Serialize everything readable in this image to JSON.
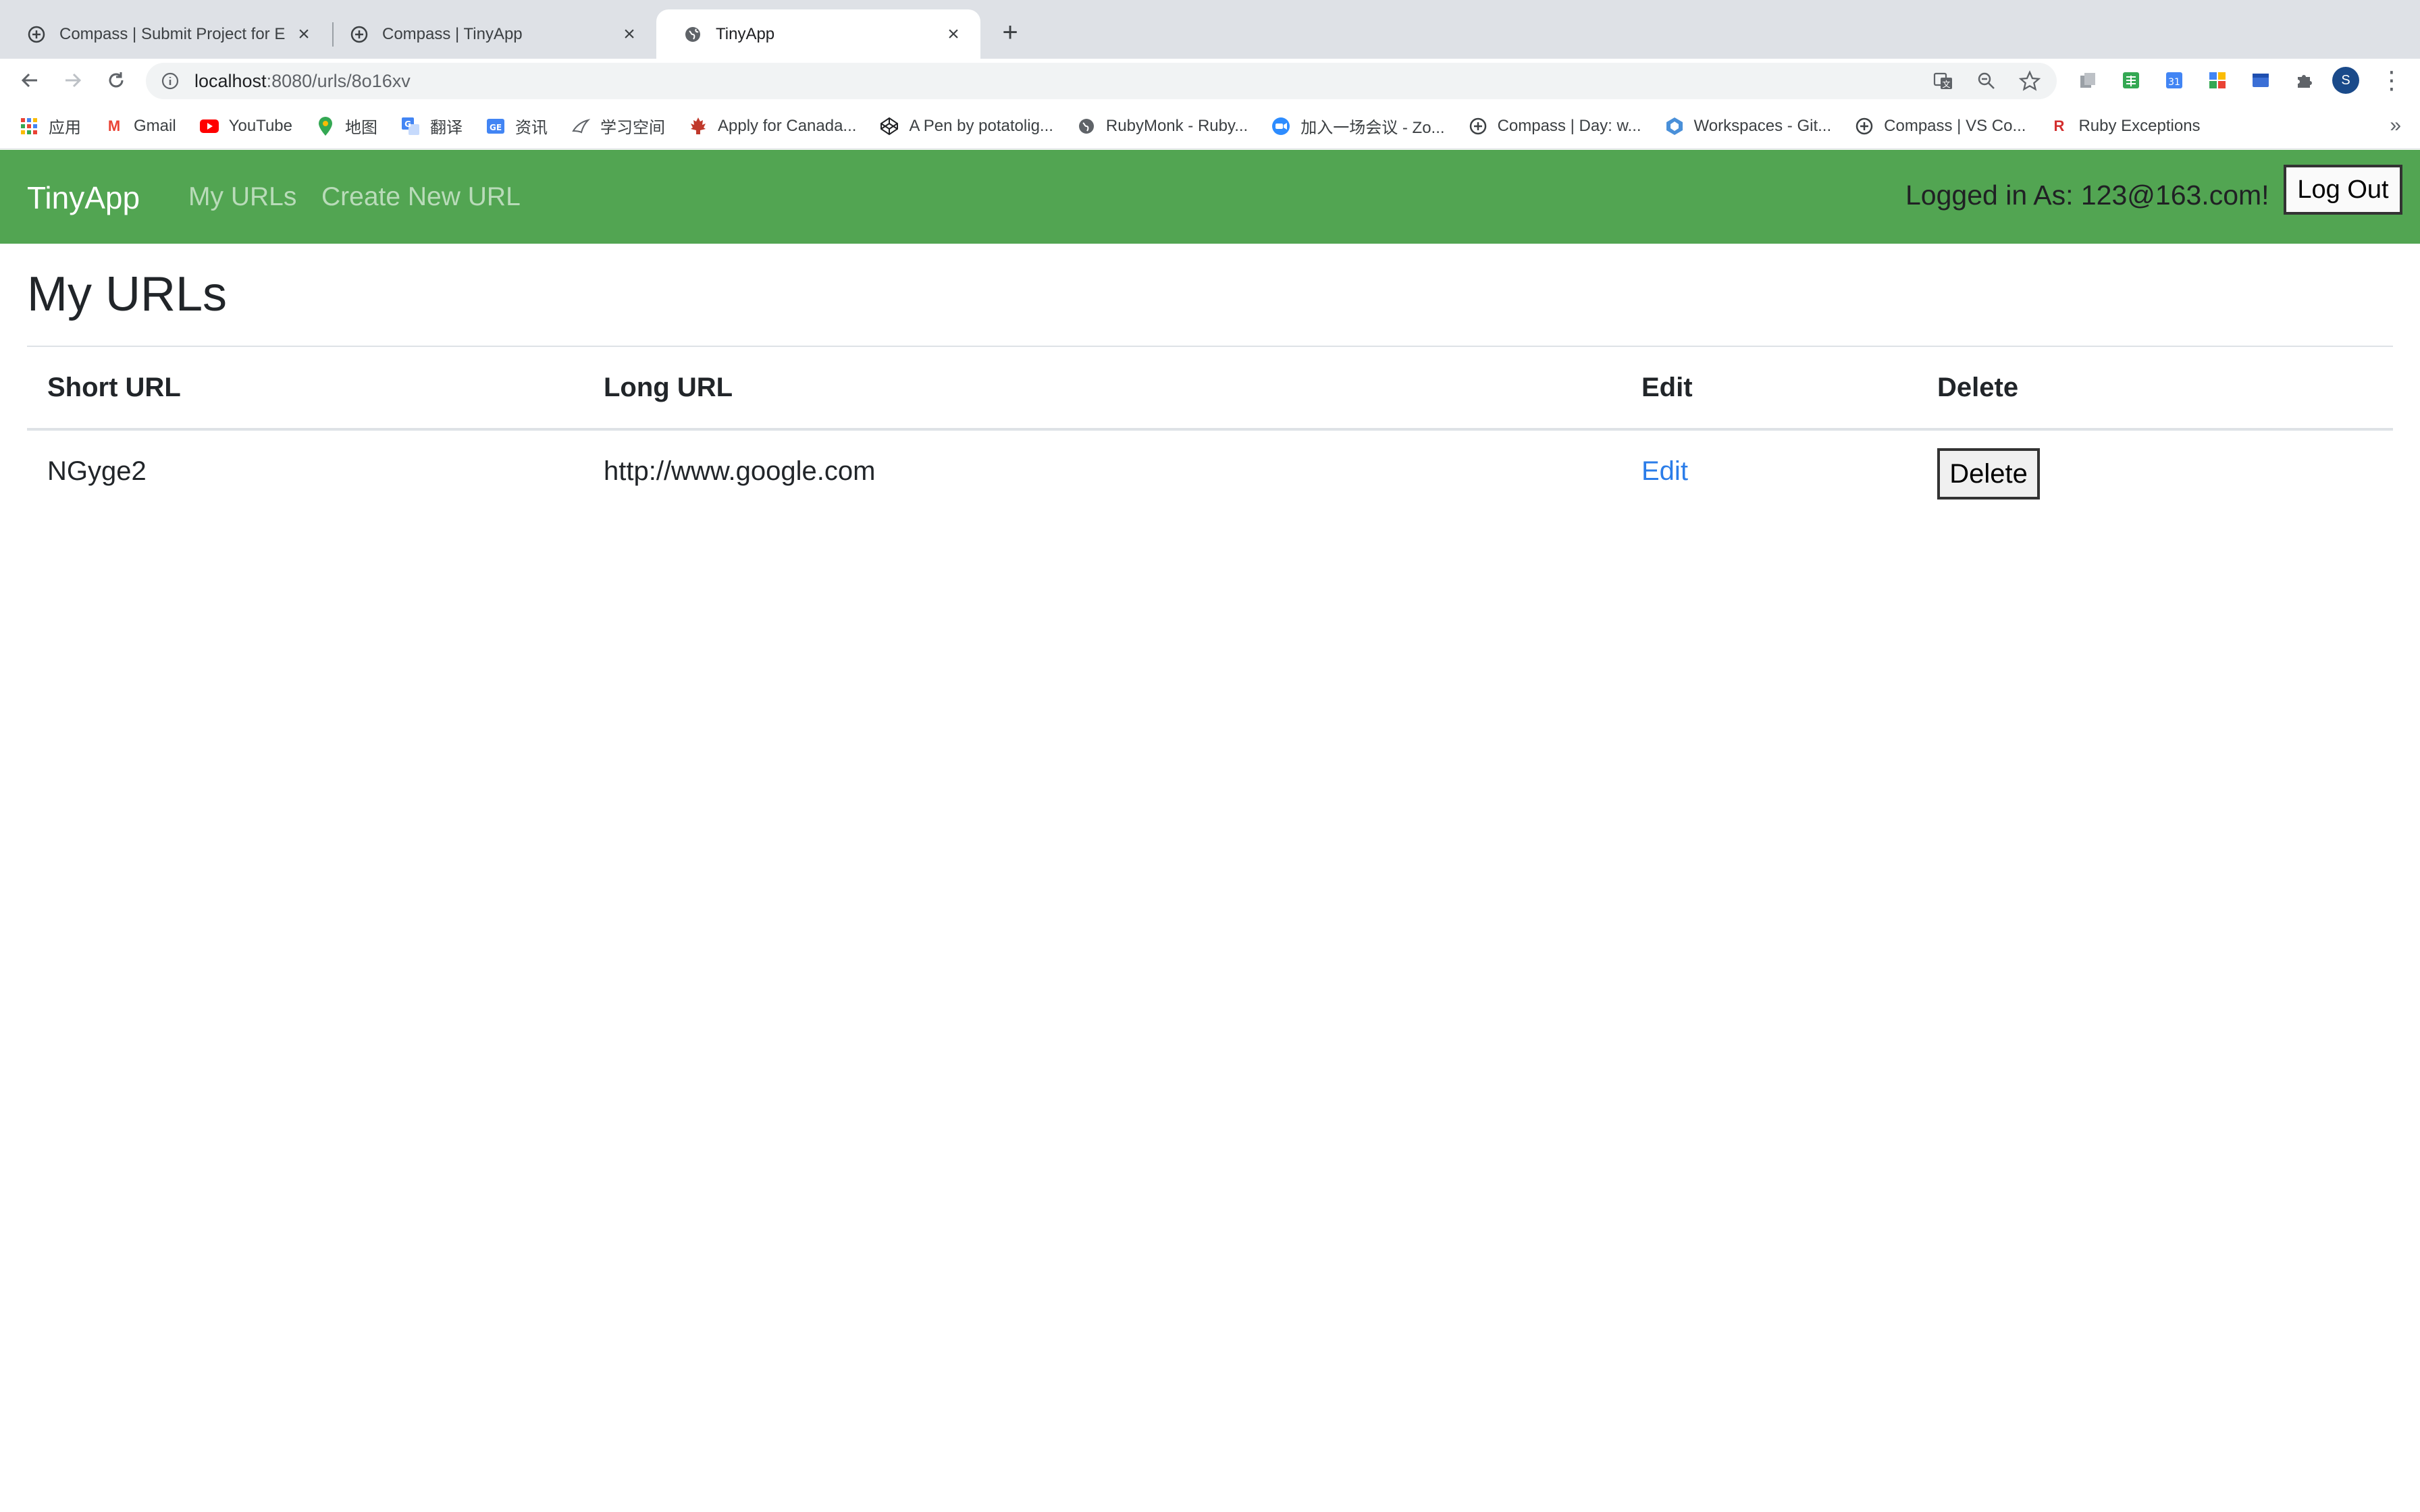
{
  "browser": {
    "tabs": [
      {
        "title": "Compass | Submit Project for E",
        "icon": "compass-icon",
        "active": false
      },
      {
        "title": "Compass | TinyApp",
        "icon": "compass-icon",
        "active": false
      },
      {
        "title": "TinyApp",
        "icon": "globe-icon",
        "active": true
      }
    ],
    "url": {
      "host": "localhost",
      "path": ":8080/urls/8o16xv"
    },
    "avatar_letter": "S",
    "bookmarks": [
      {
        "label": "应用",
        "icon": "apps-grid-icon"
      },
      {
        "label": "Gmail",
        "icon": "gmail-icon"
      },
      {
        "label": "YouTube",
        "icon": "youtube-icon"
      },
      {
        "label": "地图",
        "icon": "maps-pin-icon"
      },
      {
        "label": "翻译",
        "icon": "translate-icon"
      },
      {
        "label": "资讯",
        "icon": "news-icon"
      },
      {
        "label": "学习空间",
        "icon": "study-icon"
      },
      {
        "label": "Apply for Canada...",
        "icon": "maple-leaf-icon"
      },
      {
        "label": "A Pen by potatolig...",
        "icon": "codepen-icon"
      },
      {
        "label": "RubyMonk - Ruby...",
        "icon": "globe-icon"
      },
      {
        "label": "加入一场会议 - Zo...",
        "icon": "zoom-icon"
      },
      {
        "label": "Compass | Day: w...",
        "icon": "compass-icon"
      },
      {
        "label": "Workspaces - Git...",
        "icon": "workspaces-icon"
      },
      {
        "label": "Compass | VS Co...",
        "icon": "compass-icon"
      },
      {
        "label": "Ruby Exceptions",
        "icon": "ruby-r-icon"
      }
    ],
    "more": "»"
  },
  "navbar": {
    "brand": "TinyApp",
    "links": [
      "My URLs",
      "Create New URL"
    ],
    "logged_in_text": "Logged in As: 123@163.com!",
    "logout_label": "Log Out",
    "color": "#52a552"
  },
  "main": {
    "title": "My URLs",
    "table": {
      "headers": [
        "Short URL",
        "Long URL",
        "Edit",
        "Delete"
      ],
      "rows": [
        {
          "short_url": "NGyge2",
          "long_url": "http://www.google.com",
          "edit": "Edit",
          "delete": "Delete"
        }
      ]
    },
    "link_color": "#2b7de9"
  }
}
